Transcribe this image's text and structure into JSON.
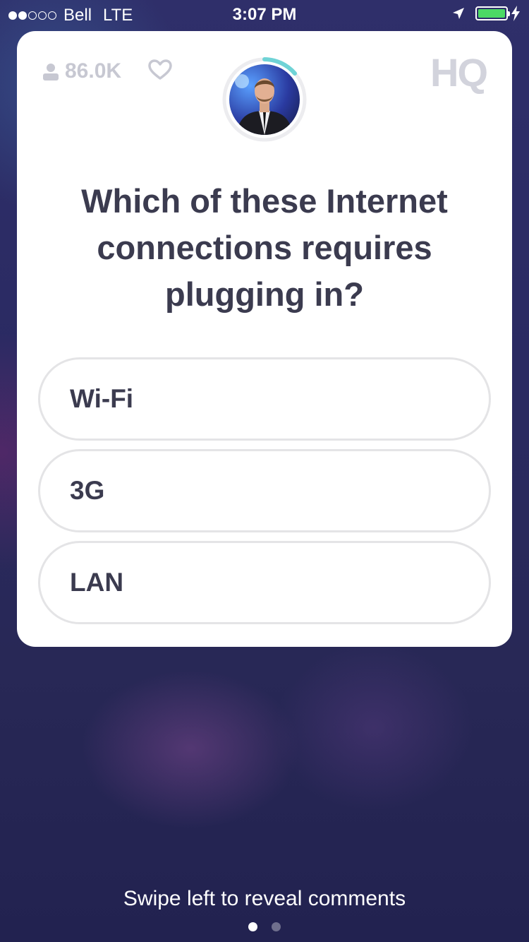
{
  "status_bar": {
    "carrier": "Bell",
    "network": "LTE",
    "time": "3:07 PM",
    "signal_bars_filled": 2,
    "signal_bars_total": 5,
    "battery_level": 1.0,
    "battery_color": "#4cd964"
  },
  "header": {
    "viewer_count": "86.0K",
    "logo_text": "HQ",
    "timer_ring_color": "#6fd3d6"
  },
  "question": {
    "text": "Which of these Internet connections requires plugging in?"
  },
  "answers": [
    {
      "label": "Wi-Fi"
    },
    {
      "label": "3G"
    },
    {
      "label": "LAN"
    }
  ],
  "footer": {
    "swipe_hint": "Swipe left to reveal comments",
    "page_count": 2,
    "active_page": 1
  },
  "colors": {
    "card_bg": "#ffffff",
    "text_dark": "#3b3b4f",
    "muted": "#c7c8d2",
    "answer_border": "#e4e4e6"
  }
}
